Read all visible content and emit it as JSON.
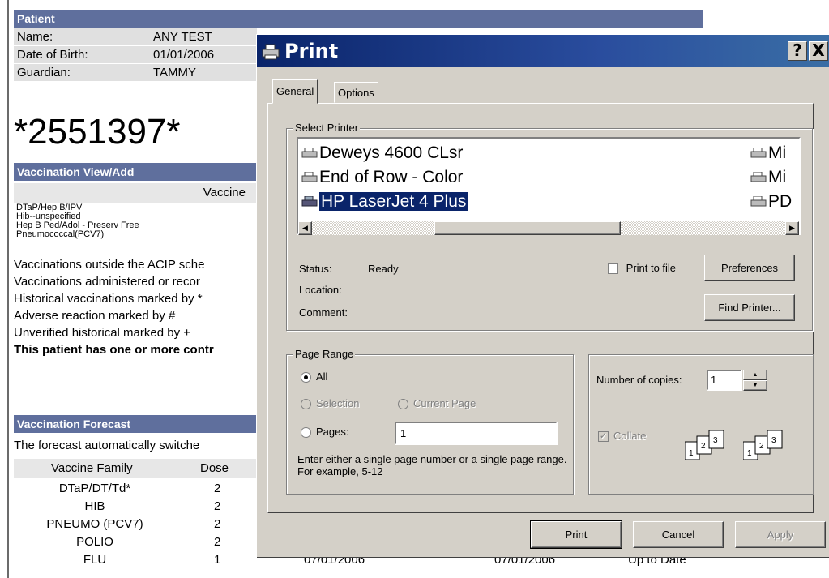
{
  "patient": {
    "header": "Patient",
    "fields": [
      {
        "label": "Name:",
        "value": "ANY TEST"
      },
      {
        "label": "Date of Birth:",
        "value": "01/01/2006"
      },
      {
        "label": "Guardian:",
        "value": "TAMMY"
      }
    ],
    "barcode": "*2551397*"
  },
  "vaccination_view": {
    "header": "Vaccination View/Add",
    "column": "Vaccine",
    "items": [
      "DTaP/Hep B/IPV",
      "Hib--unspecified",
      "Hep B Ped/Adol - Preserv Free",
      "Pneumococcal(PCV7)"
    ],
    "notes": [
      "Vaccinations outside the ACIP sche",
      "Vaccinations administered or recor",
      "Historical vaccinations marked by *",
      "Adverse reaction marked by #",
      "Unverified historical marked by +"
    ],
    "warning": "This patient has one or more contr"
  },
  "forecast": {
    "header": "Vaccination Forecast",
    "intro": "The forecast automatically switche",
    "columns": [
      "Vaccine Family",
      "Dose"
    ],
    "rows": [
      {
        "family": "DTaP/DT/Td*",
        "dose": "2"
      },
      {
        "family": "HIB",
        "dose": "2"
      },
      {
        "family": "PNEUMO (PCV7)",
        "dose": "2"
      },
      {
        "family": "POLIO",
        "dose": "2"
      },
      {
        "family": "FLU",
        "dose": "1",
        "date1": "07/01/2006",
        "date2": "07/01/2006",
        "status": "Up to Date"
      }
    ]
  },
  "dialog": {
    "title": "Print",
    "help": "?",
    "close": "X",
    "tabs": [
      "General",
      "Options"
    ],
    "select_printer": {
      "label": "Select Printer",
      "printers": [
        "Deweys 4600 CLsr",
        "End of Row - Color",
        "HP LaserJet 4 Plus"
      ],
      "printers_right": [
        "Mi",
        "Mi",
        "PD"
      ],
      "selected": "HP LaserJet 4 Plus"
    },
    "status_label": "Status:",
    "status_value": "Ready",
    "location_label": "Location:",
    "comment_label": "Comment:",
    "print_to_file": "Print to file",
    "preferences": "Preferences",
    "find_printer": "Find Printer...",
    "page_range": {
      "label": "Page Range",
      "all": "All",
      "selection": "Selection",
      "current_page": "Current Page",
      "pages": "Pages:",
      "pages_value": "1",
      "hint": "Enter either a single page number or a single page range.  For example, 5-12"
    },
    "copies": {
      "label": "Number of copies:",
      "value": "1",
      "collate": "Collate"
    },
    "buttons": {
      "print": "Print",
      "cancel": "Cancel",
      "apply": "Apply"
    },
    "colors": {
      "title_start": "#0a246a",
      "title_end": "#3a6ea5",
      "selection": "#0a246a",
      "face": "#d4d0c8"
    }
  }
}
